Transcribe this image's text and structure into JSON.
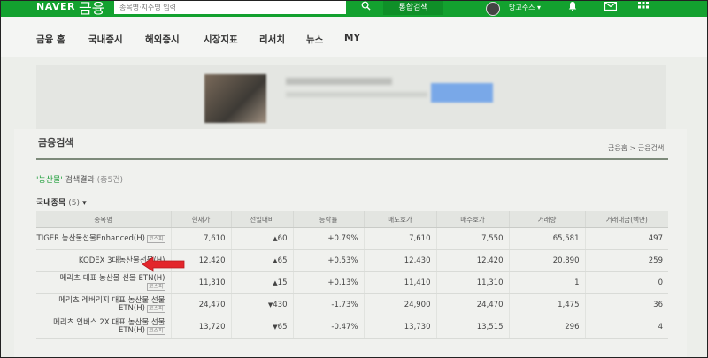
{
  "header": {
    "logo": "NAVER",
    "logo_sub": "금융",
    "search_placeholder": "종목명·지수명 입력",
    "total_search": "통합검색",
    "username": "망고주스 ▾"
  },
  "nav": {
    "items": [
      "금융 홈",
      "국내증시",
      "해외증시",
      "시장지표",
      "리서치",
      "뉴스",
      "MY"
    ]
  },
  "section": {
    "title": "금융검색",
    "breadcrumb": "금융홈 > 금융검색",
    "query": "'농산물'",
    "result_text": "검색결과",
    "result_count": "(총5건)",
    "domestic_label": "국내종목",
    "domestic_count": "(5)",
    "domestic_chevron": "▾"
  },
  "table": {
    "headers": [
      "종목명",
      "현재가",
      "전일대비",
      "등락률",
      "매도호가",
      "매수호가",
      "거래량",
      "거래대금(백만)"
    ],
    "rows": [
      {
        "name": "TIGER 농산물선물Enhanced(H)",
        "badge": "코스피",
        "price": "7,610",
        "change": "60",
        "dir": "up",
        "rate": "+0.79%",
        "ask": "7,610",
        "bid": "7,550",
        "volume": "65,581",
        "amount": "497"
      },
      {
        "name": "KODEX 3대농산물선물(H)",
        "badge": "코스피",
        "price": "12,420",
        "change": "65",
        "dir": "up",
        "rate": "+0.53%",
        "ask": "12,430",
        "bid": "12,420",
        "volume": "20,890",
        "amount": "259"
      },
      {
        "name": "메리츠 대표 농산물 선물 ETN(H)",
        "badge": "코스피",
        "price": "11,310",
        "change": "15",
        "dir": "up",
        "rate": "+0.13%",
        "ask": "11,410",
        "bid": "11,310",
        "volume": "1",
        "amount": "0"
      },
      {
        "name": "메리츠 레버리지 대표 농산물 선물 ETN(H)",
        "badge": "코스피",
        "price": "24,470",
        "change": "430",
        "dir": "down",
        "rate": "-1.73%",
        "ask": "24,900",
        "bid": "24,470",
        "volume": "1,475",
        "amount": "36"
      },
      {
        "name": "메리츠 인버스 2X 대표 농산물 선물 ETN(H)",
        "badge": "코스피",
        "price": "13,720",
        "change": "65",
        "dir": "down",
        "rate": "-0.47%",
        "ask": "13,730",
        "bid": "13,515",
        "volume": "296",
        "amount": "4"
      }
    ]
  },
  "colors": {
    "brand_green": "#13a12f",
    "up_red": "#d9262b",
    "down_blue": "#2a59c8",
    "pointer_red": "#e3262b"
  },
  "icons": {
    "search": "search-icon",
    "bell": "bell-icon",
    "mail": "mail-icon",
    "grid": "grid-icon",
    "pointer": "red-arrow-pointer-icon"
  }
}
